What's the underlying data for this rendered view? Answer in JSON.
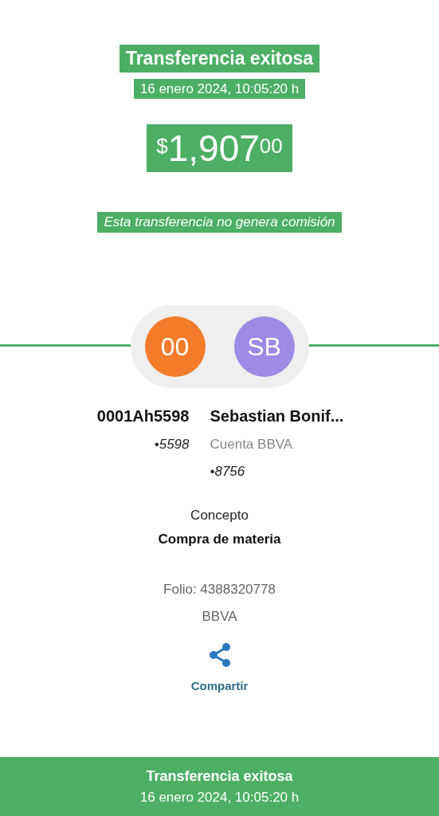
{
  "header": {
    "title": "Transferencia exitosa",
    "datetime": "16 enero 2024, 10:05:20 h",
    "amount": {
      "currency": "$",
      "whole": "1,907",
      "cents": "00"
    },
    "note": "Esta transferencia no genera comisión"
  },
  "parties": [
    {
      "initials": "00",
      "color": "#f47b2a",
      "name": "0001Ah5598",
      "account": "•5598"
    },
    {
      "initials": "SB",
      "color": "#9d8be6",
      "name": "Sebastian Bonif...",
      "bank": "Cuenta BBVA",
      "account": "•8756"
    }
  ],
  "concept": {
    "label": "Concepto",
    "value": "Compra de materia"
  },
  "folio": "Folio: 4388320778",
  "bank": "BBVA",
  "share": {
    "label": "Compartir"
  },
  "footer": {
    "title": "Transferencia exitosa",
    "datetime": "16 enero 2024, 10:05:20 h"
  }
}
